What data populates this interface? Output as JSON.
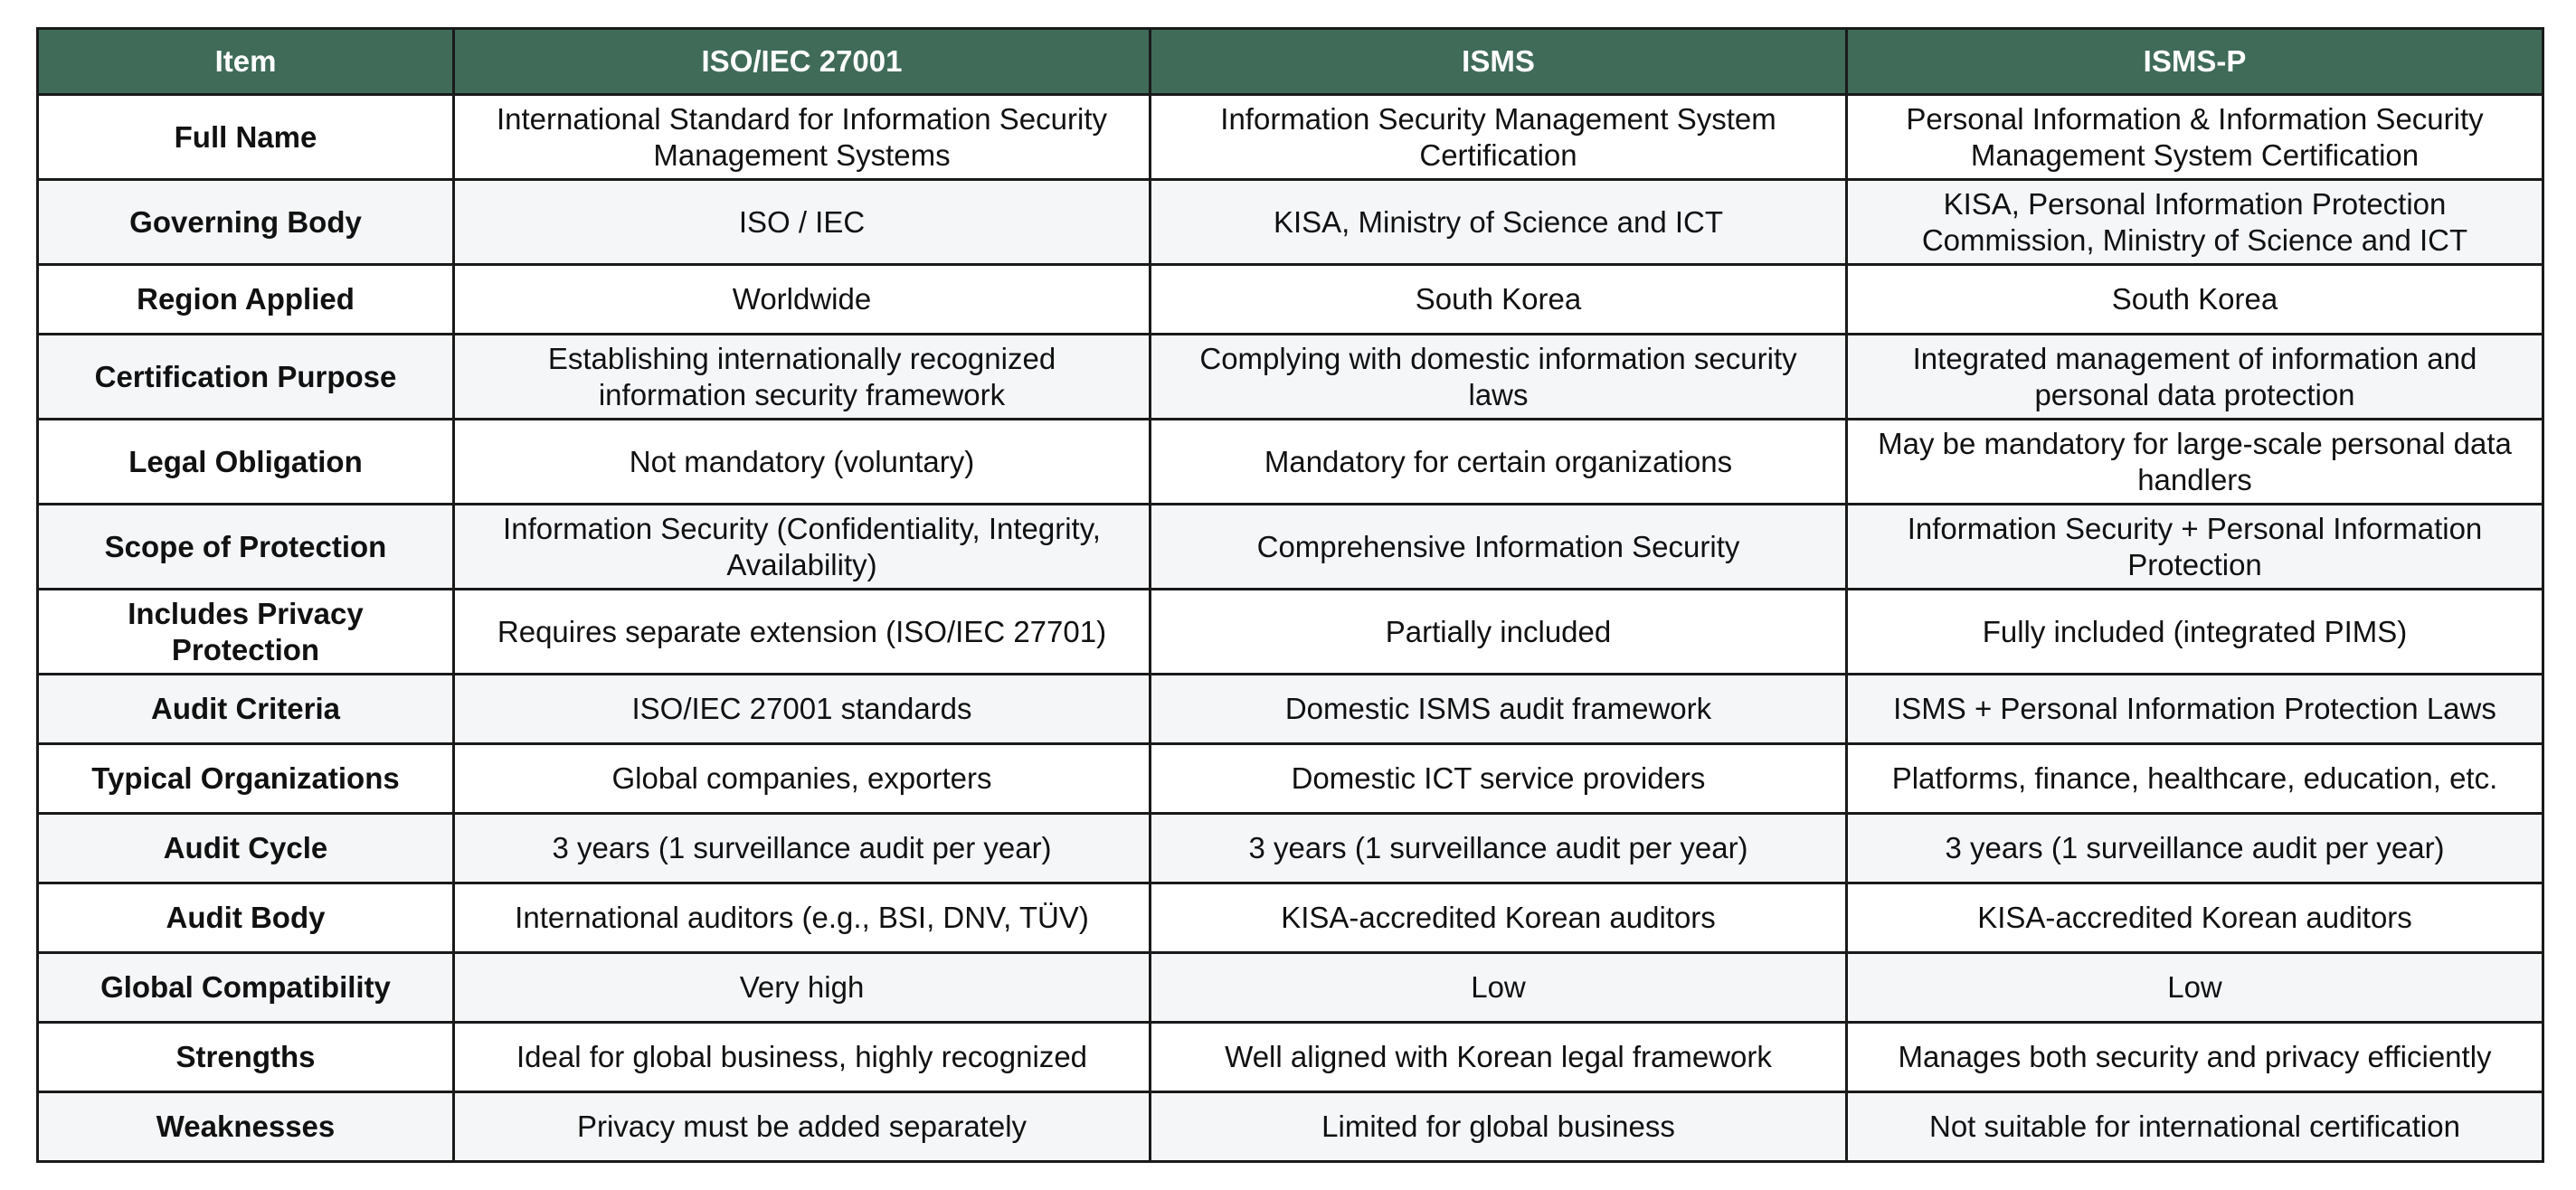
{
  "table": {
    "headers": [
      "Item",
      "ISO/IEC 27001",
      "ISMS",
      "ISMS-P"
    ],
    "rows": [
      {
        "item": "Full Name",
        "iso": "International Standard for Information Security Management Systems",
        "isms": "Information Security Management System Certification",
        "ismsp": "Personal Information & Information Security Management System Certification"
      },
      {
        "item": "Governing Body",
        "iso": "ISO / IEC",
        "isms": "KISA, Ministry of Science and ICT",
        "ismsp": "KISA, Personal Information Protection Commission, Ministry of Science and ICT"
      },
      {
        "item": "Region Applied",
        "iso": "Worldwide",
        "isms": "South Korea",
        "ismsp": "South Korea"
      },
      {
        "item": "Certification Purpose",
        "iso": "Establishing internationally recognized information security framework",
        "isms": "Complying with domestic information security laws",
        "ismsp": "Integrated management of information and personal data protection"
      },
      {
        "item": "Legal Obligation",
        "iso": "Not mandatory (voluntary)",
        "isms": "Mandatory for certain organizations",
        "ismsp": "May be mandatory for large-scale personal data handlers"
      },
      {
        "item": "Scope of Protection",
        "iso": "Information Security (Confidentiality, Integrity, Availability)",
        "isms": "Comprehensive Information Security",
        "ismsp": "Information Security + Personal Information Protection"
      },
      {
        "item": "Includes Privacy Protection",
        "iso": "Requires separate extension (ISO/IEC 27701)",
        "isms": "Partially included",
        "ismsp": "Fully included (integrated PIMS)"
      },
      {
        "item": "Audit Criteria",
        "iso": "ISO/IEC 27001 standards",
        "isms": "Domestic ISMS audit framework",
        "ismsp": "ISMS + Personal Information Protection Laws"
      },
      {
        "item": "Typical Organizations",
        "iso": "Global companies, exporters",
        "isms": "Domestic ICT service providers",
        "ismsp": "Platforms, finance, healthcare, education, etc."
      },
      {
        "item": "Audit Cycle",
        "iso": "3 years (1 surveillance audit per year)",
        "isms": "3 years (1 surveillance audit per year)",
        "ismsp": "3 years (1 surveillance audit per year)"
      },
      {
        "item": "Audit Body",
        "iso": "International auditors (e.g., BSI, DNV, TÜV)",
        "isms": "KISA-accredited Korean auditors",
        "ismsp": "KISA-accredited Korean auditors"
      },
      {
        "item": "Global Compatibility",
        "iso": "Very high",
        "isms": "Low",
        "ismsp": "Low"
      },
      {
        "item": "Strengths",
        "iso": "Ideal for global business, highly recognized",
        "isms": "Well aligned with Korean legal framework",
        "ismsp": "Manages both security and privacy efficiently"
      },
      {
        "item": "Weaknesses",
        "iso": "Privacy must be added separately",
        "isms": "Limited for global business",
        "ismsp": "Not suitable for international certification"
      }
    ]
  },
  "colors": {
    "header_bg": "#3f6b58",
    "header_text": "#ffffff",
    "alt_row_bg": "#f4f6f8",
    "border": "#1a1a1a"
  }
}
